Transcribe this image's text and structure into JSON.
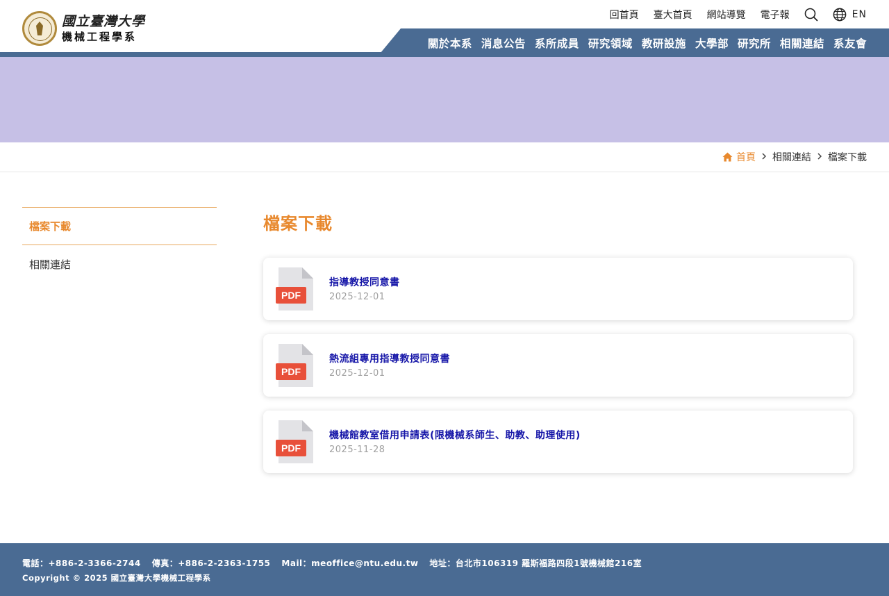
{
  "header": {
    "logo_line1": "國立臺灣大學",
    "logo_line2": "機械工程學系",
    "utility_links": [
      "回首頁",
      "臺大首頁",
      "網站導覽",
      "電子報"
    ],
    "language_label": "EN",
    "nav_items": [
      "關於本系",
      "消息公告",
      "系所成員",
      "研究領域",
      "教研設施",
      "大學部",
      "研究所",
      "相關連結",
      "系友會"
    ]
  },
  "breadcrumb": {
    "home": "首頁",
    "level1": "相關連結",
    "level2": "檔案下載"
  },
  "sidebar": {
    "items": [
      {
        "label": "檔案下載",
        "active": true
      },
      {
        "label": "相關連結",
        "active": false
      }
    ]
  },
  "main": {
    "title": "檔案下載",
    "files": [
      {
        "title": "指導教授同意書",
        "date": "2025-12-01",
        "type": "PDF"
      },
      {
        "title": "熱流組專用指導教授同意書",
        "date": "2025-12-01",
        "type": "PDF"
      },
      {
        "title": "機械館教室借用申請表(限機械系師生、助教、助理使用)",
        "date": "2025-11-28",
        "type": "PDF"
      }
    ]
  },
  "footer": {
    "phone": "電話：+886-2-3366-2744",
    "fax": "傳真：+886-2-2363-1755",
    "mail": "Mail：meoffice@ntu.edu.tw",
    "address": "地址：台北市106319 羅斯福路四段1號機械館216室",
    "copyright": "Copyright © 2025 國立臺灣大學機械工程學系"
  },
  "colors": {
    "accent": "#e8892e",
    "nav": "#4a6b93",
    "banner": "#c6c0e6",
    "link": "#1616a8",
    "pdf": "#e8503a"
  },
  "icons": {
    "search": "search-icon",
    "language": "globe-icon",
    "home": "home-icon",
    "separator": "chevron-right-icon",
    "file": "pdf-file-icon"
  }
}
